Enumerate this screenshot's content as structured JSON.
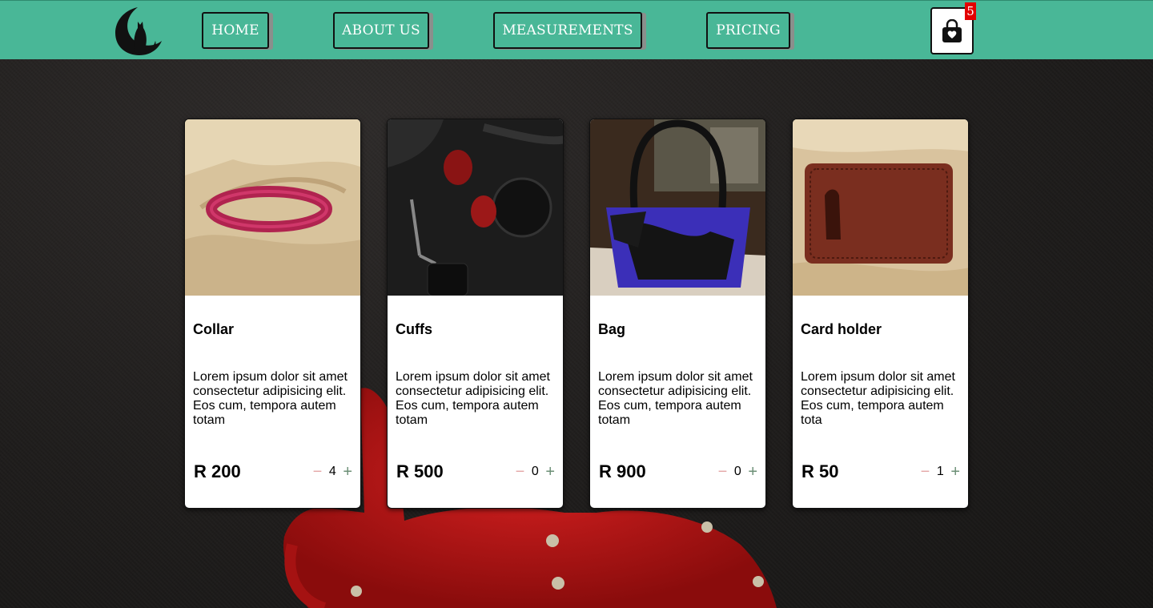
{
  "nav": {
    "items": [
      {
        "label": "HOME"
      },
      {
        "label": "ABOUT US"
      },
      {
        "label": "MEASUREMENTS"
      },
      {
        "label": "PRICING"
      }
    ],
    "cart_count": "5",
    "cart_icon": "shopping-bag-heart-icon",
    "logo_icon": "moon-cat-logo"
  },
  "colors": {
    "header": "#49b797",
    "badge": "#e30000",
    "minus": "#e4a7a7",
    "plus": "#6c8f76"
  },
  "products": [
    {
      "title": "Collar",
      "description": "Lorem ipsum dolor sit amet consectetur adipisicing elit. Eos cum, tempora autem totam",
      "price": "R 200",
      "qty": "4",
      "minus": "−",
      "plus": "+"
    },
    {
      "title": "Cuffs",
      "description": "Lorem ipsum dolor sit amet consectetur adipisicing elit. Eos cum, tempora autem totam",
      "price": "R 500",
      "qty": "0",
      "minus": "−",
      "plus": "+"
    },
    {
      "title": "Bag",
      "description": "Lorem ipsum dolor sit amet consectetur adipisicing elit. Eos cum, tempora autem totam",
      "price": "R 900",
      "qty": "0",
      "minus": "−",
      "plus": "+"
    },
    {
      "title": "Card holder",
      "description": "Lorem ipsum dolor sit amet consectetur adipisicing elit. Eos cum, tempora autem tota",
      "price": "R 50",
      "qty": "1",
      "minus": "−",
      "plus": "+"
    }
  ]
}
